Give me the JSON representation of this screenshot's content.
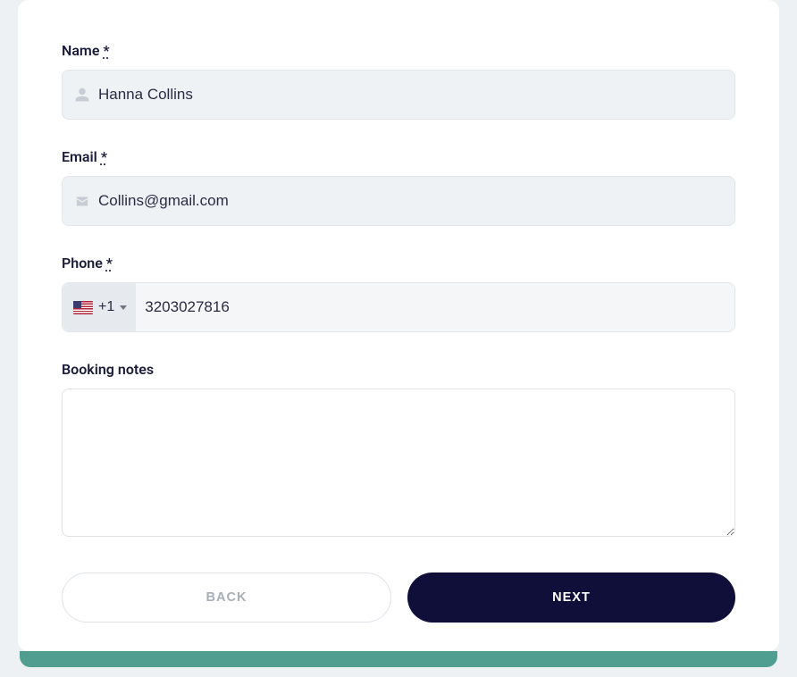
{
  "form": {
    "name": {
      "label": "Name ",
      "required_marker": "*",
      "value": "Hanna Collins"
    },
    "email": {
      "label": "Email ",
      "required_marker": "*",
      "value": "Collins@gmail.com"
    },
    "phone": {
      "label": "Phone ",
      "required_marker": "*",
      "country_code": "+1",
      "value": "3203027816"
    },
    "notes": {
      "label": "Booking notes",
      "value": ""
    }
  },
  "buttons": {
    "back": "BACK",
    "next": "NEXT"
  }
}
